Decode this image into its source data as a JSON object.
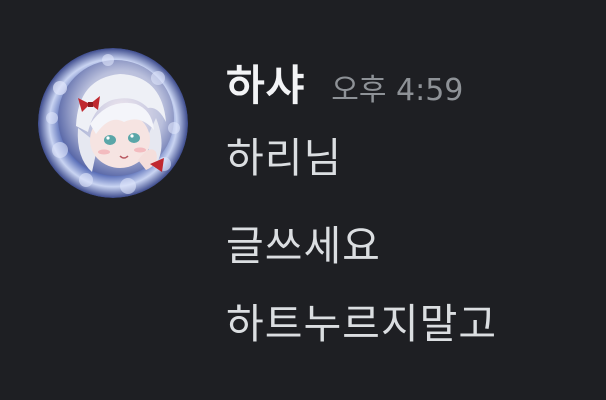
{
  "message": {
    "author": "하샤",
    "timestamp": "오후 4:59",
    "lines": [
      "하리님",
      "글쓰세요",
      "하트누르지말고"
    ]
  },
  "colors": {
    "background": "#1e1f23",
    "username": "#f2f3f5",
    "timestamp": "#8e9297",
    "text": "#dbdee1"
  }
}
